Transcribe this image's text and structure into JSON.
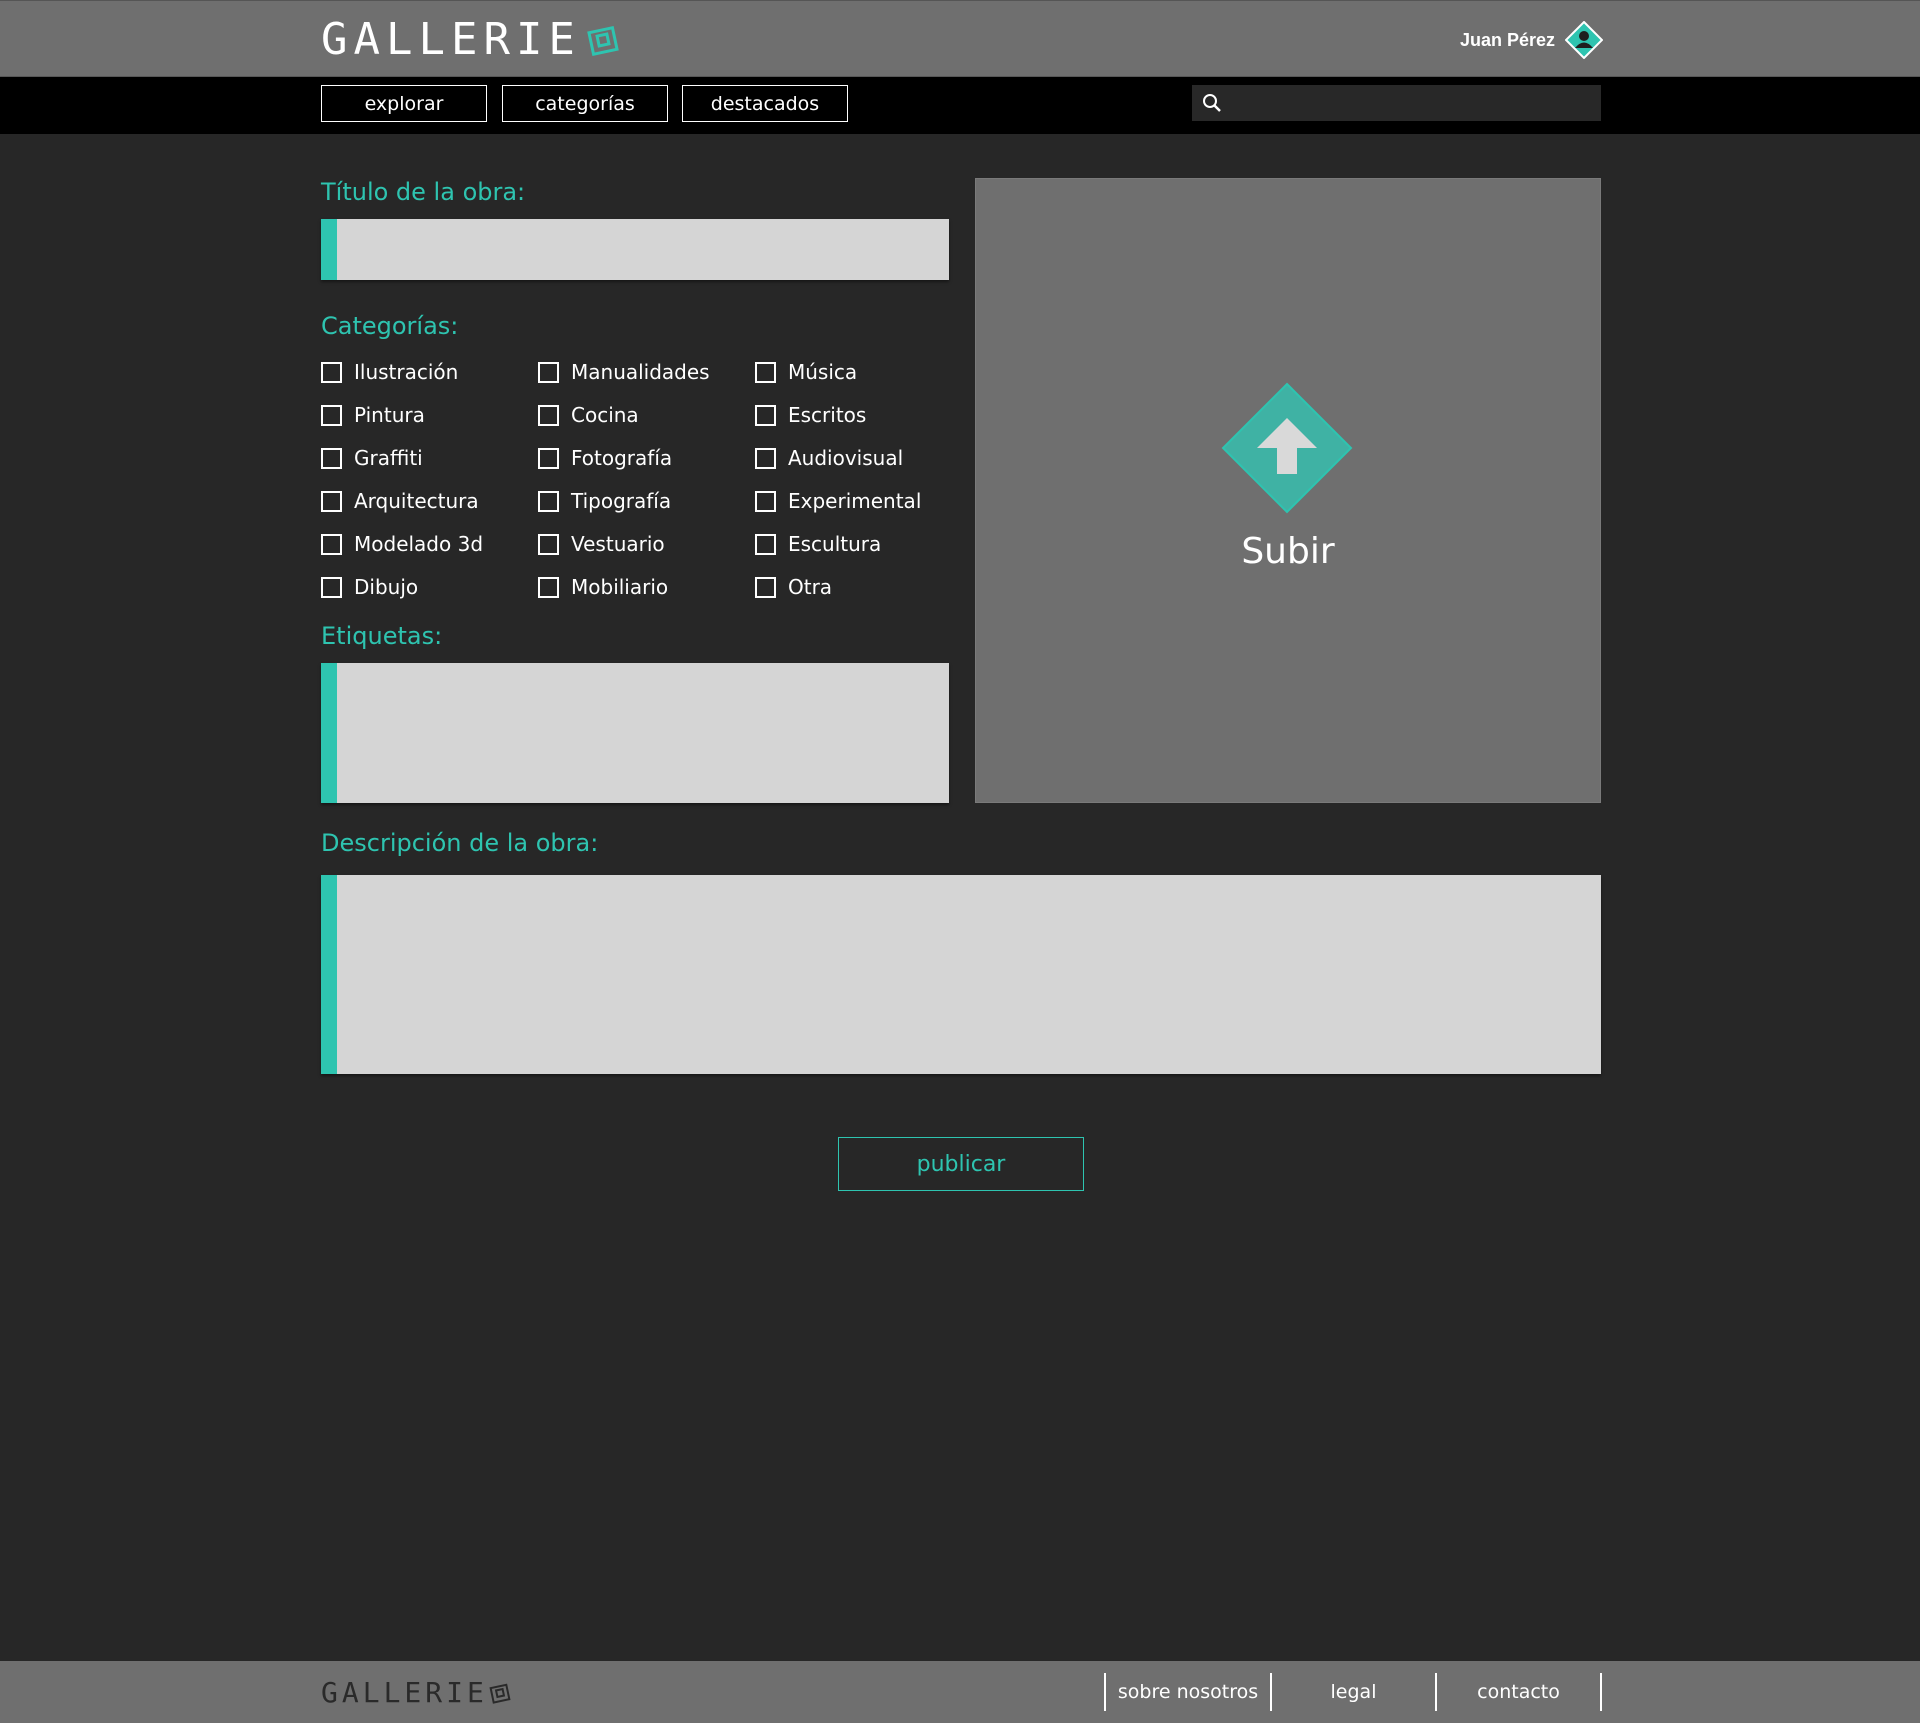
{
  "header": {
    "logo": "GALLERIE",
    "user_name": "Juan Pérez"
  },
  "nav": {
    "items": [
      "explorar",
      "categorías",
      "destacados"
    ],
    "search_placeholder": ""
  },
  "form": {
    "title_label": "Título de la obra:",
    "categories_label": "Categorías:",
    "categories": [
      [
        "Ilustración",
        "Manualidades",
        "Música"
      ],
      [
        "Pintura",
        "Cocina",
        "Escritos"
      ],
      [
        "Graffiti",
        "Fotografía",
        "Audiovisual"
      ],
      [
        "Arquitectura",
        "Tipografía",
        "Experimental"
      ],
      [
        "Modelado 3d",
        "Vestuario",
        "Escultura"
      ],
      [
        "Dibujo",
        "Mobiliario",
        "Otra"
      ]
    ],
    "tags_label": "Etiquetas:",
    "description_label": "Descripción de la obra:",
    "upload_label": "Subir",
    "publish_label": "publicar"
  },
  "footer": {
    "logo": "GALLERIE",
    "links": [
      "sobre nosotros",
      "legal",
      "contacto"
    ]
  },
  "colors": {
    "accent": "#2ec4b0",
    "header_bg": "#6f6f6f",
    "nav_bg": "#000000",
    "page_bg": "#272727",
    "field_bg": "#d5d5d5"
  }
}
